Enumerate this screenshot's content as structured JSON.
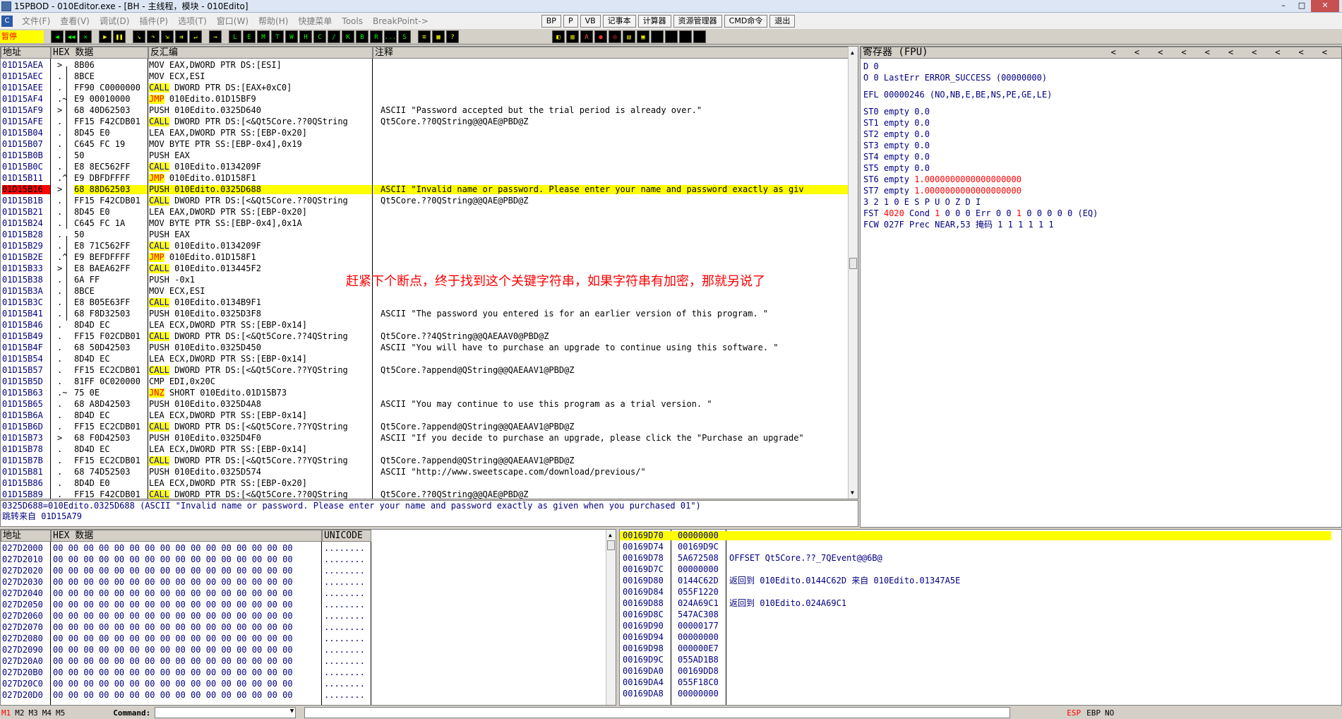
{
  "window": {
    "title": "15PBOD - 010Editor.exe - [BH - 主线程，模块 - 010Edito]",
    "min": "–",
    "max": "□",
    "close": "✕"
  },
  "menu": {
    "items": [
      "文件(F)",
      "查看(V)",
      "调试(D)",
      "插件(P)",
      "选项(T)",
      "窗口(W)",
      "帮助(H)",
      "快捷菜单",
      "Tools",
      "BreakPoint->"
    ],
    "buttons": [
      "BP",
      "P",
      "VB",
      "记事本",
      "计算器",
      "资源管理器",
      "CMD命令",
      "退出"
    ]
  },
  "toolbar": {
    "status": "暂停",
    "letters": [
      "L",
      "E",
      "M",
      "T",
      "W",
      "H",
      "C",
      "/",
      "K",
      "B",
      "R",
      "...",
      "S"
    ]
  },
  "disasm": {
    "headers": {
      "addr": "地址",
      "hex": "HEX 数据",
      "disasm": "反汇编",
      "comment": "注释"
    },
    "rows": [
      {
        "a": "01D15AEA",
        "m": ">",
        "h": "8B06",
        "d": "MOV EAX,DWORD PTR DS:[ESI]",
        "k": "",
        "c": ""
      },
      {
        "a": "01D15AEC",
        "m": ".",
        "h": "8BCE",
        "d": "MOV ECX,ESI",
        "k": "",
        "c": ""
      },
      {
        "a": "01D15AEE",
        "m": ".",
        "h": "FF90 C0000000",
        "d": "DWORD PTR DS:[EAX+0xC0]",
        "k": "CALL",
        "c": ""
      },
      {
        "a": "01D15AF4",
        "m": ".~",
        "h": "E9 00010000",
        "d": "010Edito.01D15BF9",
        "k": "JMP",
        "c": ""
      },
      {
        "a": "01D15AF9",
        "m": ">",
        "h": "68 40D62503",
        "d": "PUSH 010Edito.0325D640",
        "k": "",
        "c": "ASCII \"Password accepted but the trial period is already over.\""
      },
      {
        "a": "01D15AFE",
        "m": ".",
        "h": "FF15 F42CDB01",
        "d": "DWORD PTR DS:[<&Qt5Core.??0QString",
        "k": "CALL",
        "c": "Qt5Core.??0QString@@QAE@PBD@Z"
      },
      {
        "a": "01D15B04",
        "m": ".",
        "h": "8D45 E0",
        "d": "LEA EAX,DWORD PTR SS:[EBP-0x20]",
        "k": "",
        "c": ""
      },
      {
        "a": "01D15B07",
        "m": ".",
        "h": "C645 FC 19",
        "d": "MOV BYTE PTR SS:[EBP-0x4],0x19",
        "k": "",
        "c": ""
      },
      {
        "a": "01D15B0B",
        "m": ".",
        "h": "50",
        "d": "PUSH EAX",
        "k": "",
        "c": ""
      },
      {
        "a": "01D15B0C",
        "m": ".",
        "h": "E8 8EC562FF",
        "d": "010Edito.0134209F",
        "k": "CALL",
        "c": ""
      },
      {
        "a": "01D15B11",
        "m": ".^",
        "h": "E9 DBFDFFFF",
        "d": "010Edito.01D158F1",
        "k": "JMP",
        "c": ""
      },
      {
        "a": "01D15B16",
        "m": ">",
        "h": "68 88D62503",
        "d": "PUSH 010Edito.0325D688",
        "k": "",
        "c": "ASCII \"Invalid name or password. Please enter your name and password exactly as giv",
        "sel": true
      },
      {
        "a": "01D15B1B",
        "m": ".",
        "h": "FF15 F42CDB01",
        "d": "DWORD PTR DS:[<&Qt5Core.??0QString",
        "k": "CALL",
        "c": "Qt5Core.??0QString@@QAE@PBD@Z"
      },
      {
        "a": "01D15B21",
        "m": ".",
        "h": "8D45 E0",
        "d": "LEA EAX,DWORD PTR SS:[EBP-0x20]",
        "k": "",
        "c": ""
      },
      {
        "a": "01D15B24",
        "m": ".",
        "h": "C645 FC 1A",
        "d": "MOV BYTE PTR SS:[EBP-0x4],0x1A",
        "k": "",
        "c": ""
      },
      {
        "a": "01D15B28",
        "m": ".",
        "h": "50",
        "d": "PUSH EAX",
        "k": "",
        "c": ""
      },
      {
        "a": "01D15B29",
        "m": ".",
        "h": "E8 71C562FF",
        "d": "010Edito.0134209F",
        "k": "CALL",
        "c": ""
      },
      {
        "a": "01D15B2E",
        "m": ".^",
        "h": "E9 BEFDFFFF",
        "d": "010Edito.01D158F1",
        "k": "JMP",
        "c": ""
      },
      {
        "a": "01D15B33",
        "m": ">",
        "h": "E8 BAEA62FF",
        "d": "010Edito.013445F2",
        "k": "CALL",
        "c": ""
      },
      {
        "a": "01D15B38",
        "m": ".",
        "h": "6A FF",
        "d": "PUSH -0x1",
        "k": "",
        "c": ""
      },
      {
        "a": "01D15B3A",
        "m": ".",
        "h": "8BCE",
        "d": "MOV ECX,ESI",
        "k": "",
        "c": ""
      },
      {
        "a": "01D15B3C",
        "m": ".",
        "h": "E8 B05E63FF",
        "d": "010Edito.0134B9F1",
        "k": "CALL",
        "c": ""
      },
      {
        "a": "01D15B41",
        "m": ".",
        "h": "68 F8D32503",
        "d": "PUSH 010Edito.0325D3F8",
        "k": "",
        "c": "ASCII \"The password you entered is for an earlier version of this program. \""
      },
      {
        "a": "01D15B46",
        "m": ".",
        "h": "8D4D EC",
        "d": "LEA ECX,DWORD PTR SS:[EBP-0x14]",
        "k": "",
        "c": ""
      },
      {
        "a": "01D15B49",
        "m": ".",
        "h": "FF15 F02CDB01",
        "d": "DWORD PTR DS:[<&Qt5Core.??4QString",
        "k": "CALL",
        "c": "Qt5Core.??4QString@@QAEAAV0@PBD@Z"
      },
      {
        "a": "01D15B4F",
        "m": ".",
        "h": "68 50D42503",
        "d": "PUSH 010Edito.0325D450",
        "k": "",
        "c": "ASCII \"You will have to purchase an upgrade to continue using this software. \""
      },
      {
        "a": "01D15B54",
        "m": ".",
        "h": "8D4D EC",
        "d": "LEA ECX,DWORD PTR SS:[EBP-0x14]",
        "k": "",
        "c": ""
      },
      {
        "a": "01D15B57",
        "m": ".",
        "h": "FF15 EC2CDB01",
        "d": "DWORD PTR DS:[<&Qt5Core.??YQString",
        "k": "CALL",
        "c": "Qt5Core.?append@QString@@QAEAAV1@PBD@Z"
      },
      {
        "a": "01D15B5D",
        "m": ".",
        "h": "81FF 0C020000",
        "d": "CMP EDI,0x20C",
        "k": "",
        "c": ""
      },
      {
        "a": "01D15B63",
        "m": ".~",
        "h": "75 0E",
        "d": "SHORT 010Edito.01D15B73",
        "k": "JNZ",
        "c": ""
      },
      {
        "a": "01D15B65",
        "m": ".",
        "h": "68 A8D42503",
        "d": "PUSH 010Edito.0325D4A8",
        "k": "",
        "c": "ASCII \"You may continue to use this program as a trial version. \""
      },
      {
        "a": "01D15B6A",
        "m": ".",
        "h": "8D4D EC",
        "d": "LEA ECX,DWORD PTR SS:[EBP-0x14]",
        "k": "",
        "c": ""
      },
      {
        "a": "01D15B6D",
        "m": ".",
        "h": "FF15 EC2CDB01",
        "d": "DWORD PTR DS:[<&Qt5Core.??YQString",
        "k": "CALL",
        "c": "Qt5Core.?append@QString@@QAEAAV1@PBD@Z"
      },
      {
        "a": "01D15B73",
        "m": ">",
        "h": "68 F0D42503",
        "d": "PUSH 010Edito.0325D4F0",
        "k": "",
        "c": "ASCII \"If you decide to purchase an upgrade, please click the \"Purchase an upgrade\""
      },
      {
        "a": "01D15B78",
        "m": ".",
        "h": "8D4D EC",
        "d": "LEA ECX,DWORD PTR SS:[EBP-0x14]",
        "k": "",
        "c": ""
      },
      {
        "a": "01D15B7B",
        "m": ".",
        "h": "FF15 EC2CDB01",
        "d": "DWORD PTR DS:[<&Qt5Core.??YQString",
        "k": "CALL",
        "c": "Qt5Core.?append@QString@@QAEAAV1@PBD@Z"
      },
      {
        "a": "01D15B81",
        "m": ".",
        "h": "68 74D52503",
        "d": "PUSH 010Edito.0325D574",
        "k": "",
        "c": "ASCII \"http://www.sweetscape.com/download/previous/\""
      },
      {
        "a": "01D15B86",
        "m": ".",
        "h": "8D4D E0",
        "d": "LEA ECX,DWORD PTR SS:[EBP-0x20]",
        "k": "",
        "c": ""
      },
      {
        "a": "01D15B89",
        "m": ".",
        "h": "FF15 F42CDB01",
        "d": "DWORD PTR DS:[<&Qt5Core.??0QString",
        "k": "CALL",
        "c": "Qt5Core.??0QString@@QAE@PBD@Z"
      }
    ]
  },
  "annotation": "赶紧下个断点，终于找到这个关键字符串，如果字符串有加密，那就另说了",
  "registers": {
    "header": "寄存器 (FPU)",
    "lines": [
      "D 0",
      "O 0  LastErr ERROR_SUCCESS (00000000)",
      "",
      "EFL 00000246 (NO,NB,E,BE,NS,PE,GE,LE)",
      "",
      "ST0 empty 0.0",
      "ST1 empty 0.0",
      "ST2 empty 0.0",
      "ST3 empty 0.0",
      "ST4 empty 0.0",
      "ST5 empty 0.0"
    ],
    "st6_label": "ST6 empty ",
    "st6_val": "1.0000000000000000000",
    "st7_label": "ST7 empty ",
    "st7_val": "1.0000000000000000000",
    "fst_hdr": "               3 2 1 0      E S P U O Z D I",
    "fst_a": "FST ",
    "fst_b": "4020",
    "fst_c": "  Cond ",
    "fst_d": "1",
    "fst_e": " 0 0 0  Err 0 0 ",
    "fst_f": "1",
    "fst_g": " 0 0 0 0 0  (EQ)",
    "fcw": "FCW 027F  Prec NEAR,53  掩码    1 1 1 1 1 1"
  },
  "info": {
    "line1": "0325D688=010Edito.0325D688 (ASCII \"Invalid name or password. Please enter your name and password exactly as given when you purchased 01\")",
    "line2": "跳转来自 01D15A79"
  },
  "dump": {
    "headers": {
      "addr": "地址",
      "hex": "HEX 数据",
      "uni": "UNICODE"
    },
    "rows": [
      {
        "a": "027D2000",
        "h": "00 00 00 00 00 00 00 00 00 00 00 00 00 00 00 00",
        "u": "........"
      },
      {
        "a": "027D2010",
        "h": "00 00 00 00 00 00 00 00 00 00 00 00 00 00 00 00",
        "u": "........"
      },
      {
        "a": "027D2020",
        "h": "00 00 00 00 00 00 00 00 00 00 00 00 00 00 00 00",
        "u": "........"
      },
      {
        "a": "027D2030",
        "h": "00 00 00 00 00 00 00 00 00 00 00 00 00 00 00 00",
        "u": "........"
      },
      {
        "a": "027D2040",
        "h": "00 00 00 00 00 00 00 00 00 00 00 00 00 00 00 00",
        "u": "........"
      },
      {
        "a": "027D2050",
        "h": "00 00 00 00 00 00 00 00 00 00 00 00 00 00 00 00",
        "u": "........"
      },
      {
        "a": "027D2060",
        "h": "00 00 00 00 00 00 00 00 00 00 00 00 00 00 00 00",
        "u": "........"
      },
      {
        "a": "027D2070",
        "h": "00 00 00 00 00 00 00 00 00 00 00 00 00 00 00 00",
        "u": "........"
      },
      {
        "a": "027D2080",
        "h": "00 00 00 00 00 00 00 00 00 00 00 00 00 00 00 00",
        "u": "........"
      },
      {
        "a": "027D2090",
        "h": "00 00 00 00 00 00 00 00 00 00 00 00 00 00 00 00",
        "u": "........"
      },
      {
        "a": "027D20A0",
        "h": "00 00 00 00 00 00 00 00 00 00 00 00 00 00 00 00",
        "u": "........"
      },
      {
        "a": "027D20B0",
        "h": "00 00 00 00 00 00 00 00 00 00 00 00 00 00 00 00",
        "u": "........"
      },
      {
        "a": "027D20C0",
        "h": "00 00 00 00 00 00 00 00 00 00 00 00 00 00 00 00",
        "u": "........"
      },
      {
        "a": "027D20D0",
        "h": "00 00 00 00 00 00 00 00 00 00 00 00 00 00 00 00",
        "u": "........"
      }
    ]
  },
  "stack": {
    "rows": [
      {
        "a": "00169D70",
        "v": "00000000",
        "c": ""
      },
      {
        "a": "00169D74",
        "v": "00169D9C",
        "c": ""
      },
      {
        "a": "00169D78",
        "v": "5A672508",
        "c": "OFFSET Qt5Core.??_7QEvent@@6B@"
      },
      {
        "a": "00169D7C",
        "v": "00000000",
        "c": ""
      },
      {
        "a": "00169D80",
        "v": "0144C62D",
        "c": "返回到 010Edito.0144C62D 来自 010Edito.01347A5E"
      },
      {
        "a": "00169D84",
        "v": "055F1220",
        "c": ""
      },
      {
        "a": "00169D88",
        "v": "024A69C1",
        "c": "返回到 010Edito.024A69C1"
      },
      {
        "a": "00169D8C",
        "v": "547AC308",
        "c": ""
      },
      {
        "a": "00169D90",
        "v": "00000177",
        "c": ""
      },
      {
        "a": "00169D94",
        "v": "00000000",
        "c": ""
      },
      {
        "a": "00169D98",
        "v": "000000E7",
        "c": ""
      },
      {
        "a": "00169D9C",
        "v": "055AD1B8",
        "c": ""
      },
      {
        "a": "00169DA0",
        "v": "00169DD8",
        "c": ""
      },
      {
        "a": "00169DA4",
        "v": "055F18C0",
        "c": ""
      },
      {
        "a": "00169DA8",
        "v": "00000000",
        "c": ""
      }
    ]
  },
  "statusbar": {
    "m": [
      "M1",
      "M2",
      "M3",
      "M4",
      "M5"
    ],
    "command_label": "Command:",
    "right": [
      "ESP",
      "EBP",
      "NO"
    ]
  }
}
